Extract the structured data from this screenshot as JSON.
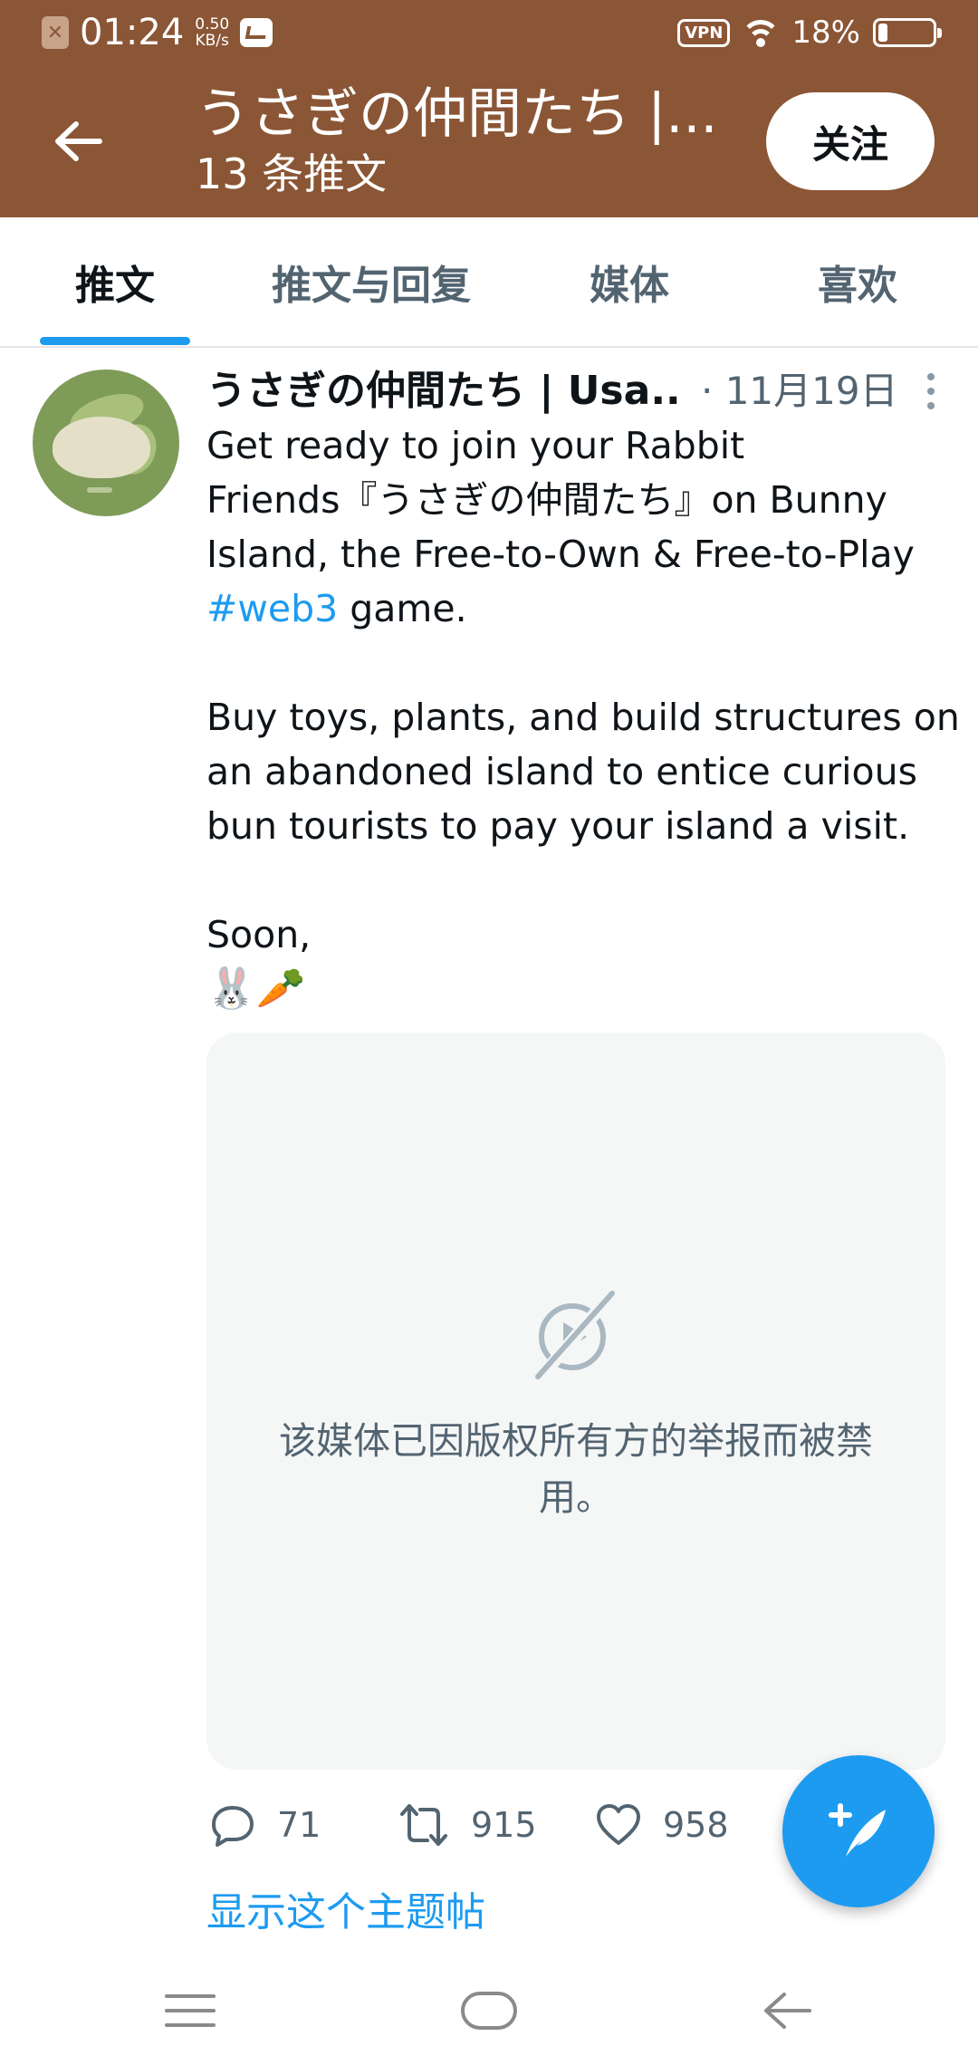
{
  "status_bar": {
    "time": "01:24",
    "net_speed_value": "0.50",
    "net_speed_unit": "KB/s",
    "vpn_label": "VPN",
    "battery_percent": "18%",
    "battery_level": 0.18
  },
  "header": {
    "title": "うさぎの仲間たち |...",
    "subtitle": "13 条推文",
    "follow_label": "关注"
  },
  "tabs": [
    {
      "label": "推文",
      "active": true
    },
    {
      "label": "推文与回复",
      "active": false
    },
    {
      "label": "媒体",
      "active": false
    },
    {
      "label": "喜欢",
      "active": false
    }
  ],
  "tweet": {
    "author": "うさぎの仲間たち | Usa...",
    "date": "· 11月19日",
    "body": {
      "line1": "Get ready to join your Rabbit",
      "line2": "Friends『うさぎの仲間たち』on Bunny",
      "line3": "Island, the Free-to-Own & Free-to-Play",
      "hashtag": "#web3",
      "line4_rest": " game.",
      "line5": "Buy toys, plants, and build structures on",
      "line6": "an abandoned island to entice curious",
      "line7": "bun tourists to pay your island a visit.",
      "line8": "Soon,",
      "emoji": "🐰🥕"
    },
    "media_message_line1": "该媒体已因版权所有方的举报而被禁",
    "media_message_line2": "用。",
    "replies": "71",
    "retweets": "915",
    "likes": "958",
    "show_thread": "显示这个主题帖"
  },
  "icons": {
    "back": "arrow-left-icon",
    "more": "more-vertical-icon",
    "media": "media-blocked-icon",
    "reply": "reply-icon",
    "retweet": "retweet-icon",
    "like": "heart-icon",
    "compose": "compose-tweet-icon",
    "nav_menu": "menu-icon",
    "nav_home": "home-icon",
    "nav_back": "back-icon"
  },
  "colors": {
    "header_bg": "#8b5636",
    "accent": "#1d9bf0",
    "secondary_text": "#536471",
    "media_bg": "#f5f7f7"
  }
}
